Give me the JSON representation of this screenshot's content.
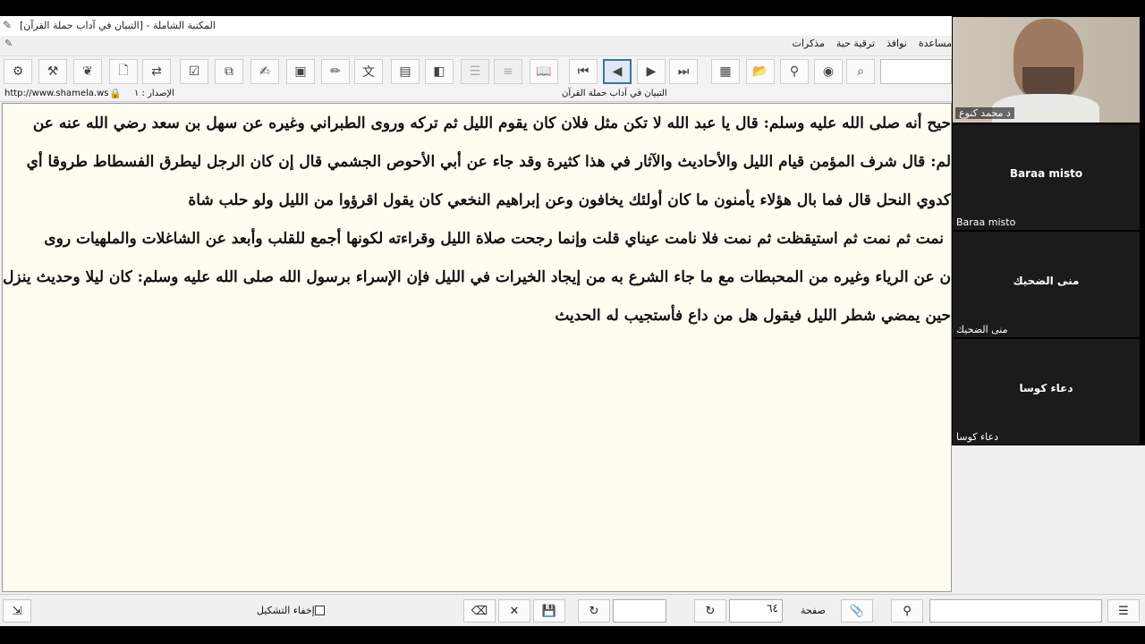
{
  "window": {
    "title": "المكتبة الشاملة - [التبيان في آداب حملة القرآن]"
  },
  "menu": [
    "مساعدة",
    "نوافذ",
    "ترقية حية",
    "مذكرات"
  ],
  "info": {
    "url": "http://www.shamela.ws",
    "version": "الإصدار : ١",
    "book_title": "التبيان في آداب حملة القرآن"
  },
  "icons": {
    "app": "app-logo-icon",
    "lock": "lock-icon"
  },
  "content": {
    "lines": [
      "حيح أنه صلى الله عليه وسلم: قال يا عبد الله لا تكن مثل فلان كان يقوم الليل ثم تركه وروى الطبراني وغيره عن سهل بن سعد رضي الله عنه عن",
      "لم: قال شرف المؤمن قيام الليل والأحاديث والآثار في هذا كثيرة وقد جاء عن أبي الأحوص الجشمي قال إن كان الرجل ليطرق الفسطاط طروقا أي",
      "كدوي النحل قال فما بال هؤلاء يأمنون ما كان أولئك يخافون وعن إبراهيم النخعي كان يقول اقرؤوا من الليل ولو حلب شاة",
      "نمت ثم نمت ثم استيقظت ثم نمت فلا نامت عيناي قلت وإنما رجحت صلاة الليل وقراءته لكونها أجمع للقلب وأبعد عن الشاغلات والملهيات روى",
      "ن عن الرياء وغيره من المحبطات مع ما جاء الشرع به من إيجاد الخيرات في الليل فإن الإسراء برسول الله صلى الله عليه وسلم: كان ليلا وحديث ينزل",
      "حين يمضي شطر الليل فيقول هل من داع فأستجيب له الحديث"
    ]
  },
  "bottom": {
    "hide_diacritics_label": "إخفاء التشكيل",
    "page_label": "صفحة",
    "page_value": "٦٤",
    "search_value": ""
  },
  "participants": [
    {
      "name": "د محمد كنوع",
      "camera": true
    },
    {
      "name": "Baraa misto",
      "corner": "Baraa misto",
      "camera": false
    },
    {
      "name": "منى الضحيك",
      "corner": "منى الضحيك",
      "camera": false
    },
    {
      "name": "دعاء كوسا",
      "corner": "دعاء كوسا",
      "camera": false
    }
  ]
}
